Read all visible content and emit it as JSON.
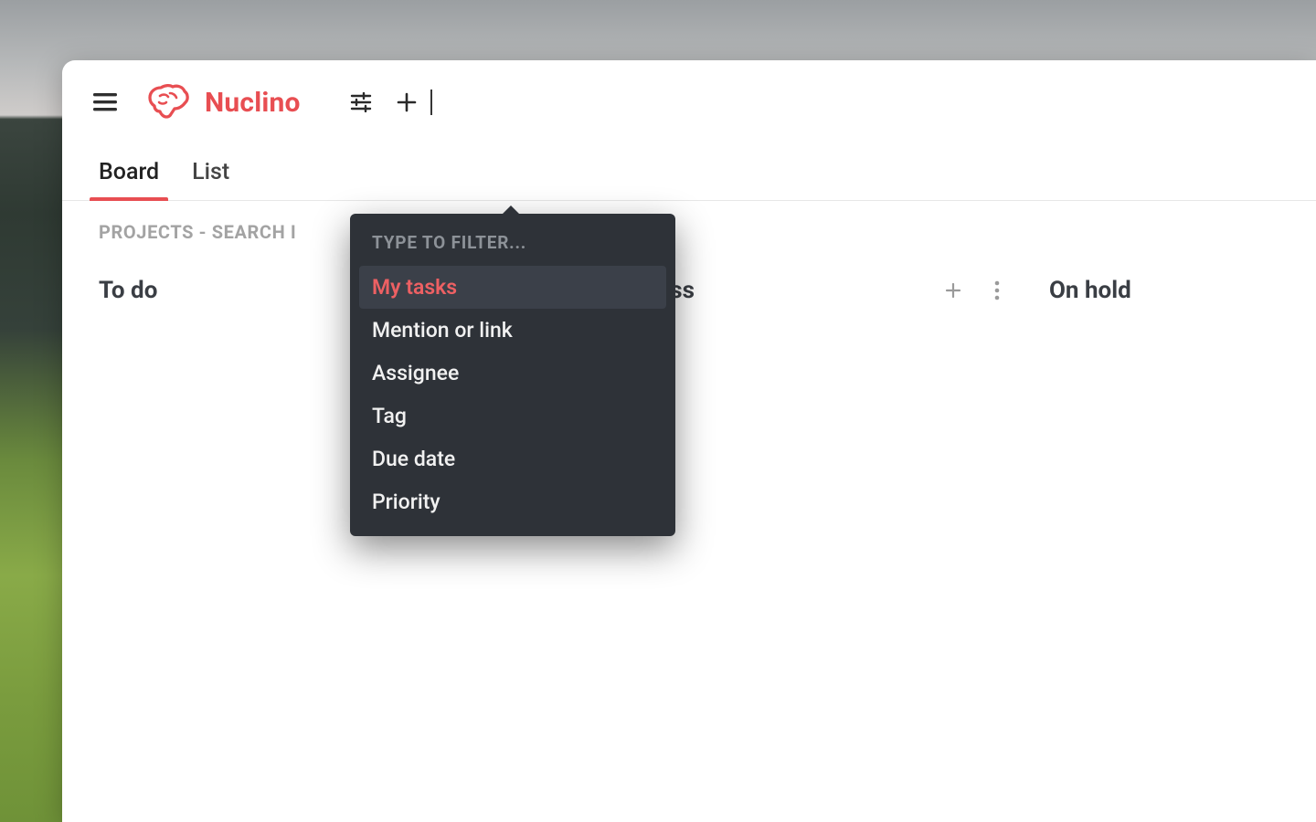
{
  "brand": {
    "name": "Nuclino"
  },
  "tabs": [
    {
      "label": "Board",
      "active": true
    },
    {
      "label": "List",
      "active": false
    }
  ],
  "breadcrumb": "PROJECTS - SEARCH I",
  "board": {
    "columns": [
      {
        "title": "To do"
      },
      {
        "title": "In progress"
      },
      {
        "title": "On hold"
      }
    ]
  },
  "filter_menu": {
    "placeholder": "TYPE TO FILTER...",
    "items": [
      {
        "label": "My tasks",
        "selected": true
      },
      {
        "label": "Mention or link"
      },
      {
        "label": "Assignee"
      },
      {
        "label": "Tag"
      },
      {
        "label": "Due date"
      },
      {
        "label": "Priority"
      }
    ]
  }
}
